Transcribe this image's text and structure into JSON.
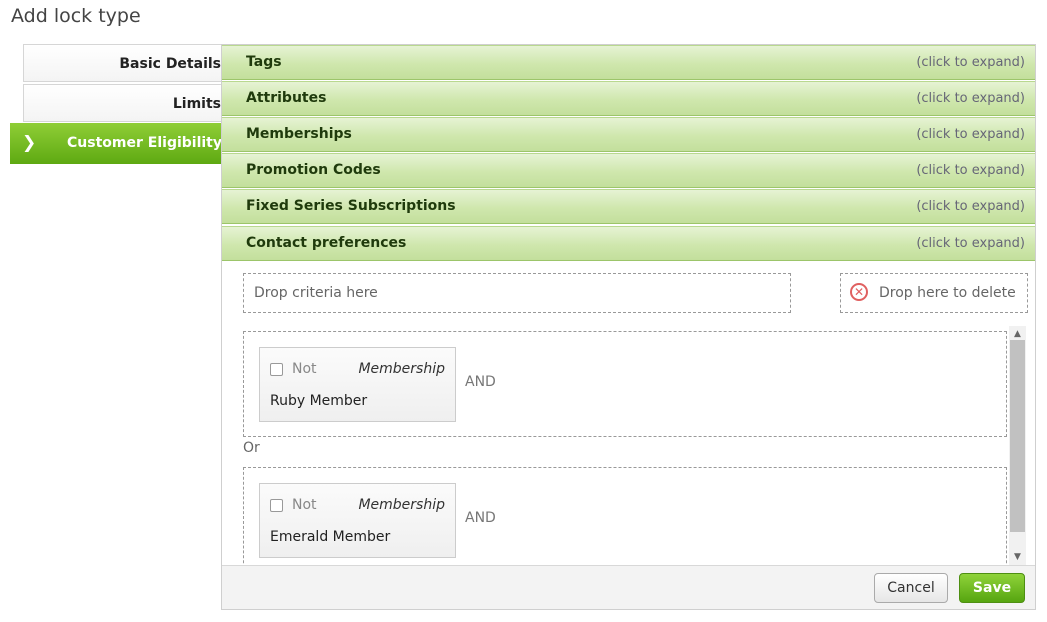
{
  "page": {
    "title": "Add lock type"
  },
  "nav": {
    "items": [
      {
        "label": "Basic Details"
      },
      {
        "label": "Limits"
      },
      {
        "label": "Customer Eligibility"
      }
    ],
    "active_chevron": "❯"
  },
  "accordions": [
    {
      "title": "Tags",
      "hint": "(click to expand)"
    },
    {
      "title": "Attributes",
      "hint": "(click to expand)"
    },
    {
      "title": "Memberships",
      "hint": "(click to expand)"
    },
    {
      "title": "Promotion Codes",
      "hint": "(click to expand)"
    },
    {
      "title": "Fixed Series Subscriptions",
      "hint": "(click to expand)"
    },
    {
      "title": "Contact preferences",
      "hint": "(click to expand)"
    }
  ],
  "drop": {
    "criteria_label": "Drop criteria here",
    "delete_label": "Drop here to delete"
  },
  "groups": [
    {
      "not_label": "Not",
      "type": "Membership",
      "value": "Ruby Member",
      "and_label": "AND"
    },
    {
      "not_label": "Not",
      "type": "Membership",
      "value": "Emerald Member",
      "and_label": "AND"
    }
  ],
  "or_label": "Or",
  "footer": {
    "cancel_label": "Cancel",
    "save_label": "Save"
  }
}
